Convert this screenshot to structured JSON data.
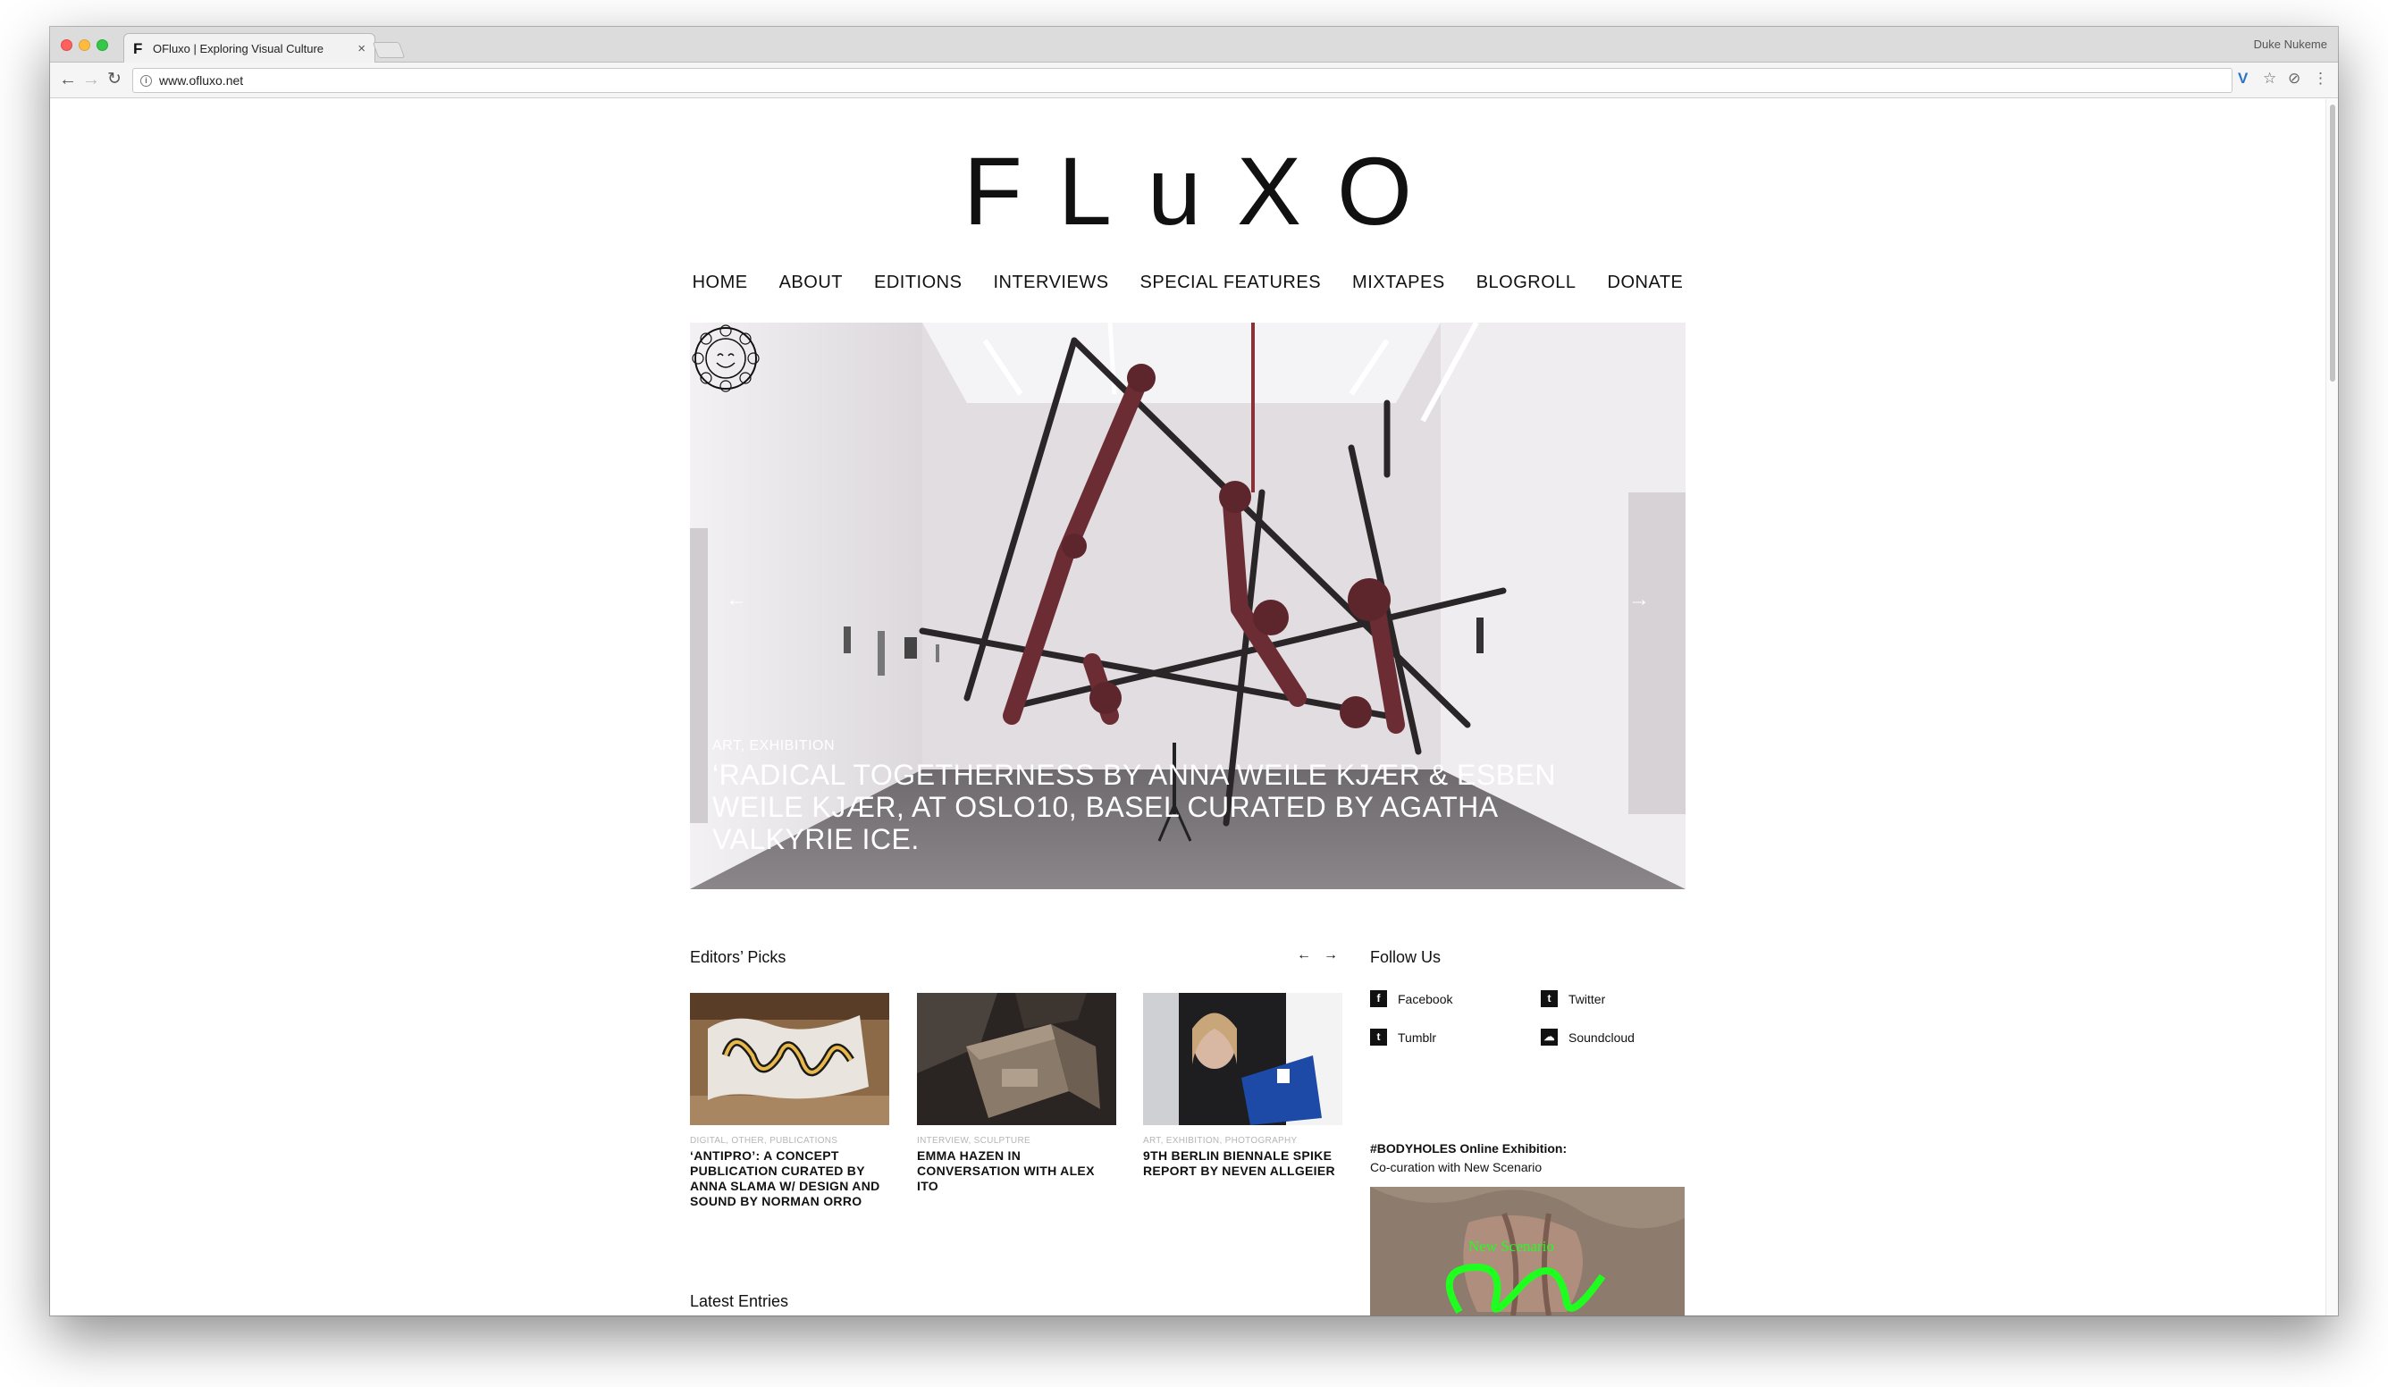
{
  "browser": {
    "tab_title": "OFluxo | Exploring Visual Culture",
    "tab_favicon": "F",
    "tab_close": "×",
    "profile_name": "Duke Nukeme",
    "url": "www.ofluxo.net",
    "back_icon": "←",
    "forward_icon": "→",
    "reload_icon": "↻",
    "info_icon": "i",
    "ext_v_icon": "V",
    "star_icon": "☆",
    "ext_icon": "⊘",
    "menu_icon": "⋮"
  },
  "site": {
    "logo": "FLuXO",
    "nav": [
      "HOME",
      "ABOUT",
      "EDITIONS",
      "INTERVIEWS",
      "SPECIAL FEATURES",
      "MIXTAPES",
      "BLOGROLL",
      "DONATE"
    ]
  },
  "hero": {
    "prev_icon": "←",
    "next_icon": "→",
    "categories": "ART, EXHIBITION",
    "title": "‘RADICAL TOGETHERNESS BY ANNA WEILE KJÆR & ESBEN WEILE KJÆR, AT OSLO10, BASEL CURATED BY AGATHA VALKYRIE ICE."
  },
  "editors_picks": {
    "heading": "Editors’ Picks",
    "prev_icon": "←",
    "next_icon": "→",
    "items": [
      {
        "categories": "DIGITAL, OTHER, PUBLICATIONS",
        "title": "‘ANTIPRO’: A CONCEPT PUBLICATION CURATED BY ANNA SLAMA W/ DESIGN AND SOUND BY NORMAN ORRO"
      },
      {
        "categories": "INTERVIEW, SCULPTURE",
        "title": "EMMA HAZEN IN CONVERSATION WITH ALEX ITO"
      },
      {
        "categories": "ART, EXHIBITION, PHOTOGRAPHY",
        "title": "9TH BERLIN BIENNALE SPIKE REPORT BY NEVEN ALLGEIER"
      }
    ]
  },
  "latest": {
    "heading": "Latest Entries"
  },
  "sidebar": {
    "follow_heading": "Follow Us",
    "social": [
      {
        "label": "Facebook",
        "glyph": "f",
        "icon": "facebook-icon"
      },
      {
        "label": "Twitter",
        "glyph": "t",
        "icon": "twitter-icon"
      },
      {
        "label": "Tumblr",
        "glyph": "t",
        "icon": "tumblr-icon"
      },
      {
        "label": "Soundcloud",
        "glyph": "☁",
        "icon": "soundcloud-icon"
      }
    ],
    "bodyholes_title": "#BODYHOLES Online Exhibition:",
    "bodyholes_sub": "Co-curation with New Scenario",
    "bodyholes_image_text": "New Scenario"
  },
  "colors": {
    "text": "#111111",
    "category_grey": "#b5b5b5",
    "hero_overlay_text": "#ffffff",
    "neon_green": "#1fff1f"
  }
}
